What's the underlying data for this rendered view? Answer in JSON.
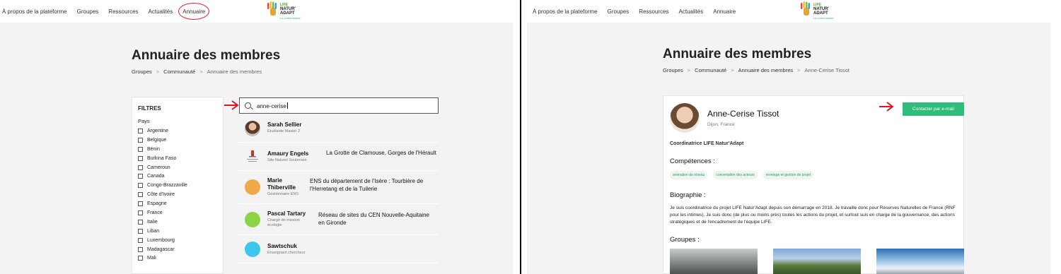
{
  "nav": {
    "links": [
      "À propos de la plateforme",
      "Groupes",
      "Ressources",
      "Actualités",
      "Annuaire"
    ]
  },
  "logo": {
    "line1": "LIFE",
    "line2": "NATUR'",
    "line3": "ADAPT",
    "line4": "La communauté"
  },
  "left": {
    "title": "Annuaire des membres",
    "breadcrumb": [
      "Groupes",
      "Communauté",
      "Annuaire des membres"
    ],
    "filters": {
      "title": "FILTRES",
      "section": "Pays",
      "countries": [
        "Argentine",
        "Belgique",
        "Bénin",
        "Burkina Faso",
        "Cameroun",
        "Canada",
        "Congo-Brazzaville",
        "Côte d'Ivoire",
        "Espagne",
        "France",
        "Italie",
        "Liban",
        "Luxembourg",
        "Madagascar",
        "Mali"
      ]
    },
    "search": {
      "value": "anne-cerise"
    },
    "results": [
      {
        "name": "Sarah Sellier",
        "role": "Etudiante Master 2",
        "org": ""
      },
      {
        "name": "Amaury Engels",
        "role": "Site Naturel Souterrain",
        "org": "La Grotte de Clamouse, Gorges de l'Hérault"
      },
      {
        "name": "Marie Thiberville",
        "role": "Gestionnaire ENS",
        "org": "ENS du département de l'Isère : Tourbière de l'Herretang et de la Tuilerie"
      },
      {
        "name": "Pascal Tartary",
        "role": "Chargé de mission écologie",
        "org": "Réseau de sites du CEN Nouvelle-Aquitaine en Gironde"
      },
      {
        "name": "Sawtschuk",
        "role": "Enseignant chercheur",
        "org": ""
      }
    ]
  },
  "right": {
    "title": "Annuaire des membres",
    "breadcrumb": [
      "Groupes",
      "Communauté",
      "Annuaire des membres",
      "Anne-Cerise Tissot"
    ],
    "profile": {
      "name": "Anne-Cerise Tissot",
      "location": "Dijon, France",
      "contact_label": "Contacter par e-mail",
      "role": "Coordinatrice LIFE Natur'Adapt",
      "skills_heading": "Compétences :",
      "skills": [
        "animation de réseau",
        "concertation des acteurs",
        "montage et gestion de projet"
      ],
      "bio_heading": "Biographie :",
      "bio": "Je suis coordinatrice du projet LIFE Natur'Adapt depuis son démarrage en 2018. Je travaille donc pour Réserves Naturelles de France (RNF pour les intimes). Je suis donc (de plus ou moins près) toutes les actions du projet, et surtout suis en charge de la gouvernance, des actions stratégiques et de l'encadrement de l'équipe LIFE.",
      "groups_heading": "Groupes :"
    }
  },
  "colors": {
    "accent": "#2ebd7a",
    "annotation": "#d9232d"
  }
}
